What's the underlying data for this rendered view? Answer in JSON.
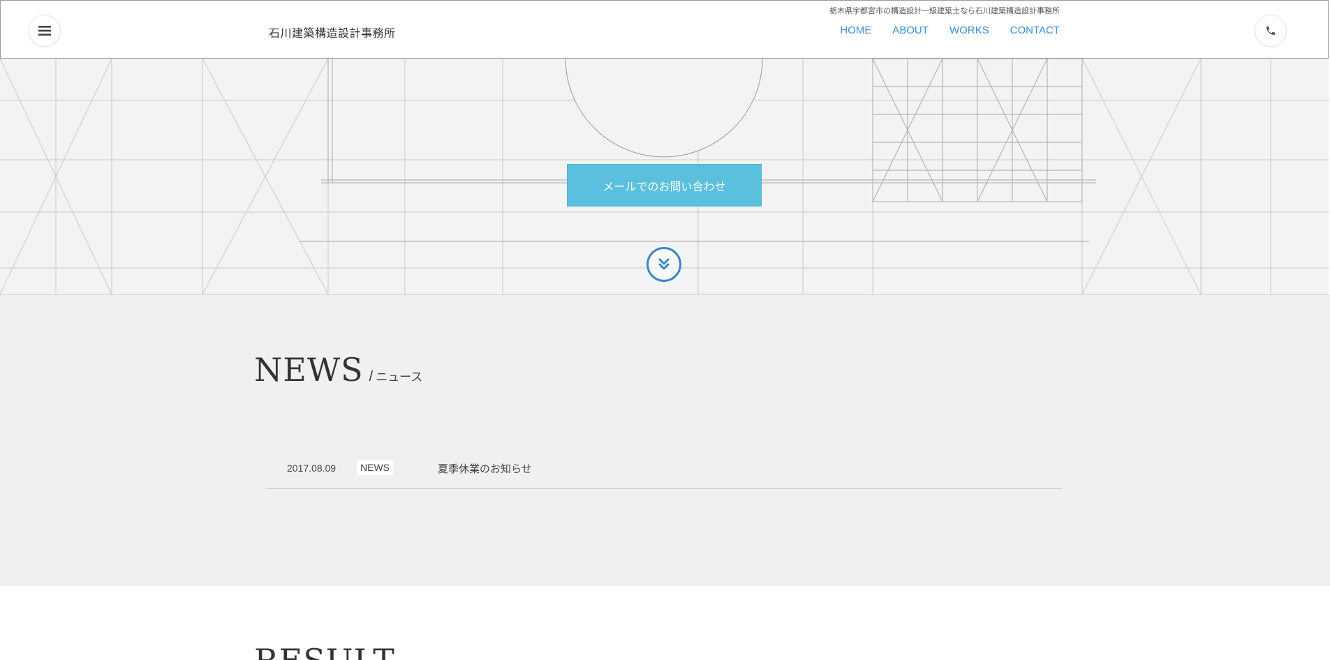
{
  "header": {
    "logo": "石川建築構造設計事務所",
    "tagline": "栃木県宇都宮市の構造設計一級建築士なら石川建築構造設計事務所",
    "nav": [
      "HOME",
      "ABOUT",
      "WORKS",
      "CONTACT"
    ],
    "menu_icon": "hamburger-menu-icon",
    "phone_icon": "phone-icon"
  },
  "hero": {
    "contact_button": "メールでのお問い合わせ",
    "scroll_icon": "double-chevron-down-icon"
  },
  "news": {
    "title": "NEWS",
    "slash": "/",
    "subtitle": "ニュース",
    "items": [
      {
        "date": "2017.08.09",
        "tag": "NEWS",
        "title": "夏季休業のお知らせ"
      }
    ]
  },
  "result": {
    "title": "RESULT",
    "slash": "/"
  },
  "colors": {
    "accent": "#3a8dd6",
    "button": "#5bc0de",
    "news_bg": "#f0f0f0"
  }
}
